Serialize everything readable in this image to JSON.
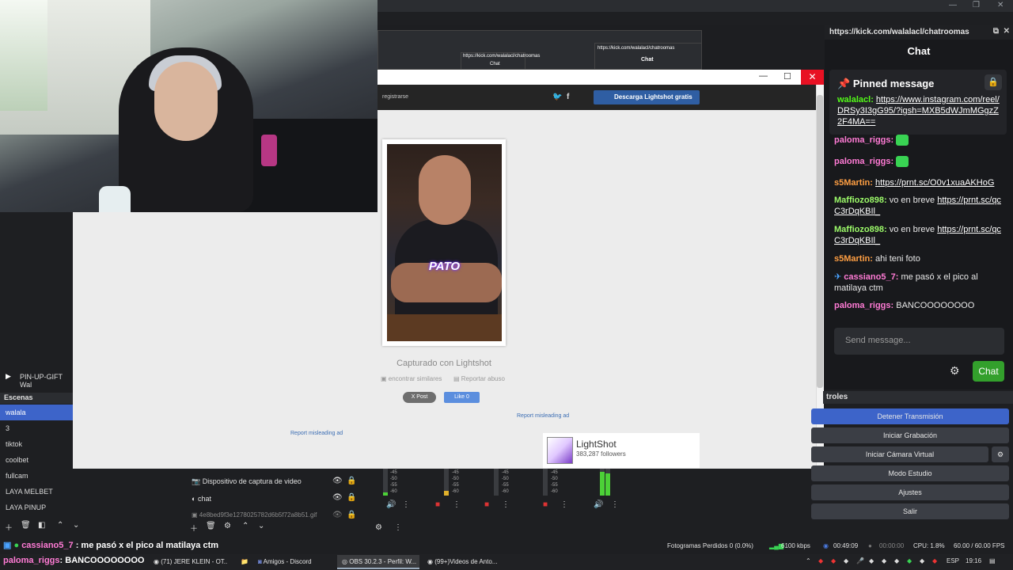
{
  "chat_panel": {
    "url": "https://kick.com/walalacl/chatroomas",
    "title": "Chat",
    "pinned": {
      "heading": "Pinned message",
      "user": "walalacl:",
      "link": "https://www.instagram.com/reel/DRSy3I3gG95/?igsh=MXB5dWJmMGgzZ2F4MA=="
    },
    "messages": [
      {
        "user": "paloma_riggs:",
        "text": ""
      },
      {
        "user": "paloma_riggs:",
        "text": ""
      },
      {
        "user": "s5Martin:",
        "text": "https://prnt.sc/O0v1xuaAKHoG"
      },
      {
        "user": "Maffiozo898:",
        "text": "vo en breve",
        "link": "https://prnt.sc/qcC3rDqKBIl_"
      },
      {
        "user": "Maffiozo898:",
        "text": "vo en breve",
        "link": "https://prnt.sc/qcC3rDqKBIl_"
      },
      {
        "user": "s5Martin:",
        "text": "ahi teni foto"
      },
      {
        "user": "cassiano5_7:",
        "text": "me pasó x el pico al matilaya ctm"
      },
      {
        "user": "paloma_riggs:",
        "text": "BANCOOOOOOOO"
      }
    ],
    "send_placeholder": "Send message...",
    "chat_button": "Chat"
  },
  "controls": {
    "heading": "troles",
    "buttons": [
      "Detener Transmisión",
      "Iniciar Grabación",
      "Iniciar Cámara Virtual",
      "Modo Estudio",
      "Ajustes",
      "Salir"
    ]
  },
  "lightshot": {
    "register": "registrarse",
    "download": "Descarga Lightshot gratis",
    "caption_overlay": "PATO",
    "captured": "Capturado con Lightshot",
    "find_similar": "encontrar similares",
    "report_abuse": "Reportar abuso",
    "x_post": "X Post",
    "fb_like": "Like 0",
    "report_ad": "Report misleading ad",
    "card_name": "LightShot",
    "card_followers": "383,287 followers"
  },
  "mini_windows": {
    "url": "https://kick.com/walalacl/chatroomas",
    "chat": "Chat"
  },
  "scenes": {
    "heading": "Escenas",
    "media_label": "PIN-UP-GIFT Wal",
    "items": [
      "walala",
      "3",
      "tiktok",
      "coolbet",
      "fullcam",
      "LAYA MELBET",
      "LAYA PINUP"
    ]
  },
  "sources": [
    "Dispositivo de captura de video",
    "chat",
    "4e8bed9f3e1278025782d6b5f72a8b51.gif"
  ],
  "mixer_db": [
    "-45",
    "-50",
    "-55",
    "-60"
  ],
  "status": {
    "ticker_user": "cassiano5_7",
    "ticker_text": ": me pasó x el pico al matilaya ctm",
    "dropped": "Fotogramas Perdidos 0 (0.0%)",
    "kbps": "6100 kbps",
    "live_time": "00:49:09",
    "rec_time": "00:00:00",
    "cpu": "CPU: 1.8%",
    "fps": "60.00 / 60.00 FPS"
  },
  "taskbar": {
    "ticker_user": "paloma_riggs",
    "ticker_text": ": BANCOOOOOOOO",
    "tasks": [
      "(71) JERE KLEIN - OT...",
      "Amigos - Discord",
      "OBS 30.2.3 - Perfil: W...",
      "(99+)Videos de Anto..."
    ],
    "lang": "ESP",
    "clock": "19:16"
  }
}
